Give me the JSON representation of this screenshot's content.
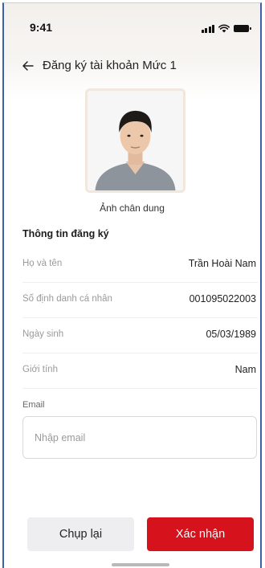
{
  "status_bar": {
    "time": "9:41"
  },
  "header": {
    "title": "Đăng ký tài khoản Mức 1"
  },
  "portrait": {
    "caption": "Ảnh chân dung"
  },
  "registration_info": {
    "section_title": "Thông tin đăng ký",
    "rows": [
      {
        "label": "Họ và tên",
        "value": "Trần Hoài Nam"
      },
      {
        "label": "Số định danh cá nhân",
        "value": "001095022003"
      },
      {
        "label": "Ngày sinh",
        "value": "05/03/1989"
      },
      {
        "label": "Giới tính",
        "value": "Nam"
      }
    ]
  },
  "email": {
    "label": "Email",
    "placeholder": "Nhập email",
    "value": ""
  },
  "actions": {
    "retake_label": "Chụp lại",
    "confirm_label": "Xác nhận"
  },
  "colors": {
    "primary": "#d6121c",
    "secondary_button": "#eeeef0",
    "frame_border": "#3f5fa8"
  }
}
